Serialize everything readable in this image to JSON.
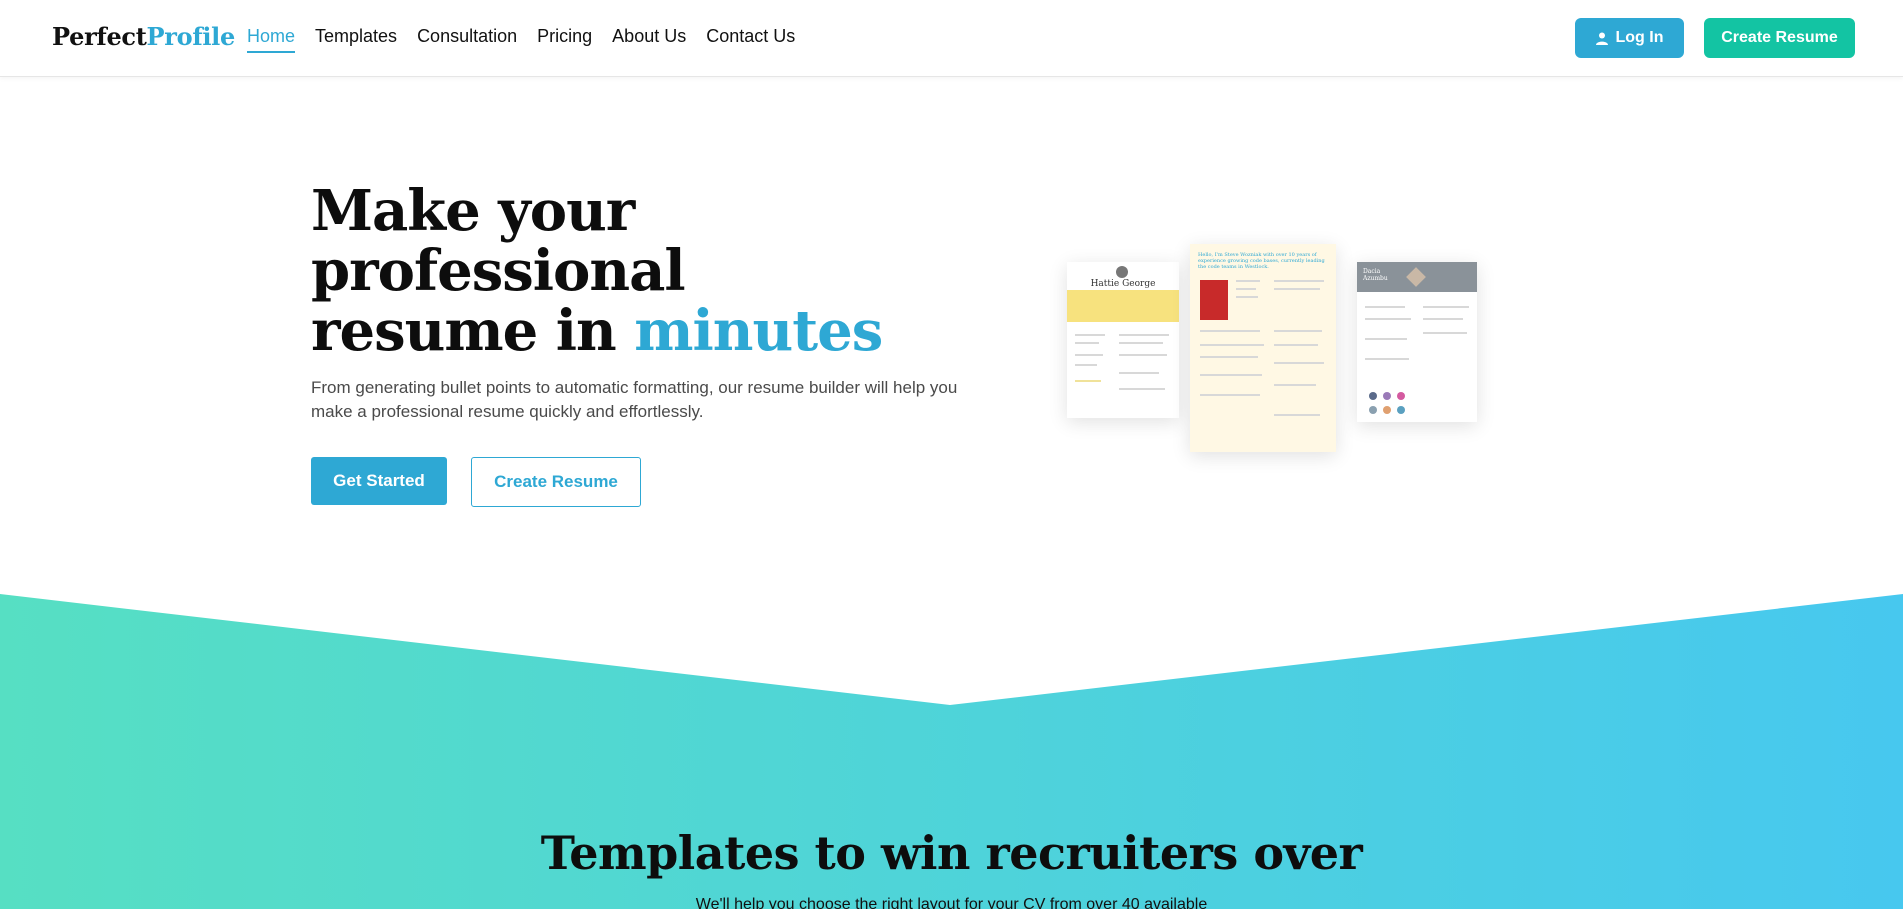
{
  "brand": {
    "part1": "Perfect",
    "part2": "Profile"
  },
  "nav": {
    "items": [
      {
        "label": "Home",
        "active": true
      },
      {
        "label": "Templates"
      },
      {
        "label": "Consultation"
      },
      {
        "label": "Pricing"
      },
      {
        "label": "About Us"
      },
      {
        "label": "Contact Us"
      }
    ],
    "login_label": "Log In",
    "login_icon": "user-icon",
    "create_label": "Create Resume"
  },
  "hero": {
    "title_line1": "Make your",
    "title_line2": "professional",
    "title_line3": "resume in ",
    "title_highlight": "minutes",
    "subtitle": "From generating bullet points to automatic formatting, our resume builder will help you make a professional resume quickly and effortlessly.",
    "primary_cta": "Get Started",
    "secondary_cta": "Create Resume"
  },
  "previews": {
    "r1_name": "Hattie George",
    "r2_headline": "Hello, I'm Steve Wozniak with over 10 years of experience growing code bases, currently leading the code teams in Westlock.",
    "r3_name": "Dacia Azumbu"
  },
  "templates_section": {
    "title": "Templates to win recruiters over",
    "subtitle": "We'll help you choose the right layout for your CV from over 40 available"
  },
  "colors": {
    "accent": "#2ea8d4",
    "green": "#13c4a3",
    "gradient_left": "#56dfc3",
    "gradient_right": "#47c8ef"
  }
}
